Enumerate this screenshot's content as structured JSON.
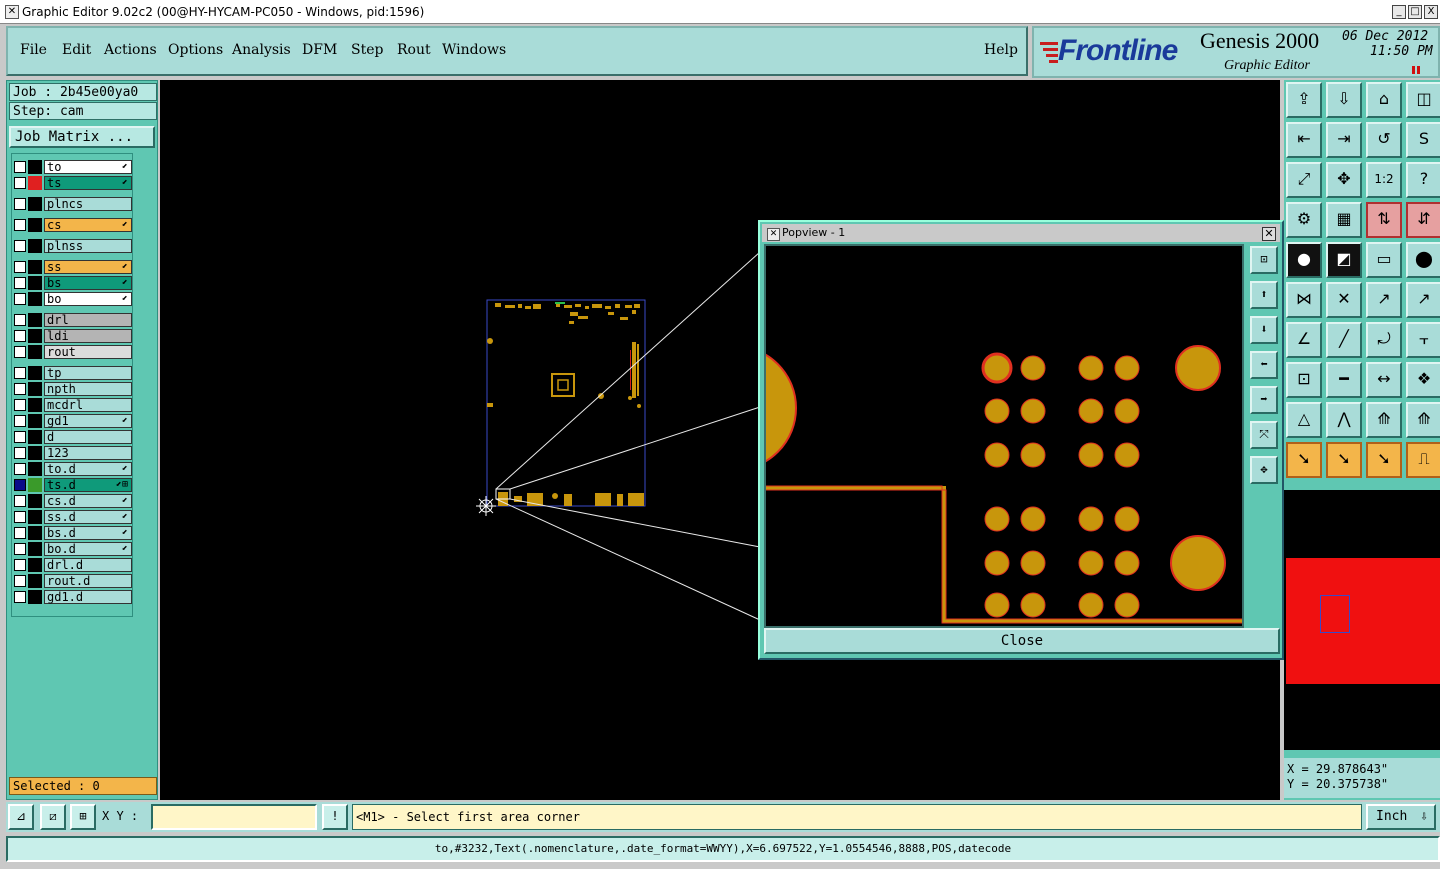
{
  "window": {
    "title": "Graphic Editor 9.02c2 (00@HY-HYCAM-PC050 - Windows, pid:1596)",
    "buttons": [
      "_",
      "□",
      "X"
    ]
  },
  "menu": {
    "items": [
      "File",
      "Edit",
      "Actions",
      "Options",
      "Analysis",
      "DFM",
      "Step",
      "Rout",
      "Windows"
    ],
    "help": "Help"
  },
  "branding": {
    "logo": "Frontline",
    "product": "Genesis 2000",
    "subtitle": "Graphic Editor",
    "date": "06 Dec 2012",
    "time": "11:50 PM"
  },
  "job": {
    "job_label": "Job : 2b45e00ya0",
    "step_label": "Step: cam",
    "matrix_button": "Job Matrix ..."
  },
  "layers": [
    {
      "name": "to",
      "color": "#ffffff",
      "swatch": "#000000",
      "flag": "⬋"
    },
    {
      "name": "ts",
      "color": "#0f9a7a",
      "swatch": "#e02020",
      "flag": "⬋"
    },
    {
      "name": "plncs",
      "color": "#a9dcd8",
      "swatch": "#000000",
      "flag": ""
    },
    {
      "name": "cs",
      "color": "#f3b54a",
      "swatch": "#000000",
      "flag": "⬋"
    },
    {
      "name": "plnss",
      "color": "#a9dcd8",
      "swatch": "#000000",
      "flag": ""
    },
    {
      "name": "ss",
      "color": "#f3b54a",
      "swatch": "#000000",
      "flag": "⬋"
    },
    {
      "name": "bs",
      "color": "#0f9a7a",
      "swatch": "#000000",
      "flag": "⬋"
    },
    {
      "name": "bo",
      "color": "#ffffff",
      "swatch": "#000000",
      "flag": "⬋"
    },
    {
      "name": "drl",
      "color": "#b4b4b4",
      "swatch": "#000000",
      "flag": ""
    },
    {
      "name": "ldi",
      "color": "#b4b4b4",
      "swatch": "#000000",
      "flag": ""
    },
    {
      "name": "rout",
      "color": "#dcdcdc",
      "swatch": "#000000",
      "flag": ""
    },
    {
      "name": "tp",
      "color": "#a9dcd8",
      "swatch": "#000000",
      "flag": ""
    },
    {
      "name": "npth",
      "color": "#a9dcd8",
      "swatch": "#000000",
      "flag": ""
    },
    {
      "name": "mcdrl",
      "color": "#a9dcd8",
      "swatch": "#000000",
      "flag": ""
    },
    {
      "name": "gd1",
      "color": "#a9dcd8",
      "swatch": "#000000",
      "flag": "⬋"
    },
    {
      "name": "d",
      "color": "#a9dcd8",
      "swatch": "#000000",
      "flag": ""
    },
    {
      "name": "123",
      "color": "#a9dcd8",
      "swatch": "#000000",
      "flag": ""
    },
    {
      "name": "to.d",
      "color": "#a9dcd8",
      "swatch": "#000000",
      "flag": "⬋"
    },
    {
      "name": "ts.d",
      "color": "#0f9a7a",
      "swatch": "#3a9a2a",
      "flag": "⬋⊞",
      "selected": true
    },
    {
      "name": "cs.d",
      "color": "#a9dcd8",
      "swatch": "#000000",
      "flag": "⬋"
    },
    {
      "name": "ss.d",
      "color": "#a9dcd8",
      "swatch": "#000000",
      "flag": "⬋"
    },
    {
      "name": "bs.d",
      "color": "#a9dcd8",
      "swatch": "#000000",
      "flag": "⬋"
    },
    {
      "name": "bo.d",
      "color": "#a9dcd8",
      "swatch": "#000000",
      "flag": "⬋"
    },
    {
      "name": "drl.d",
      "color": "#a9dcd8",
      "swatch": "#000000",
      "flag": ""
    },
    {
      "name": "rout.d",
      "color": "#a9dcd8",
      "swatch": "#000000",
      "flag": ""
    },
    {
      "name": "gd1.d",
      "color": "#a9dcd8",
      "swatch": "#000000",
      "flag": ""
    }
  ],
  "selected_label": "Selected : 0",
  "popview": {
    "title": "Popview - 1",
    "close_label": "Close"
  },
  "coords": {
    "x": "X = 29.878643\"",
    "y": "Y = 20.375738\""
  },
  "command": {
    "xy_label": "X Y :",
    "xy_value": "",
    "prompt": "<M1> - Select first area corner",
    "unit": "Inch"
  },
  "status": "to,#3232,Text(.nomenclature,.date_format=WWYY),X=6.697522,Y=1.0554546,8888,POS,datecode",
  "colors": {
    "panel": "#5fc7b2",
    "button": "#a9dcd8",
    "copper": "#c8960c",
    "pad_outline": "#e03020"
  }
}
